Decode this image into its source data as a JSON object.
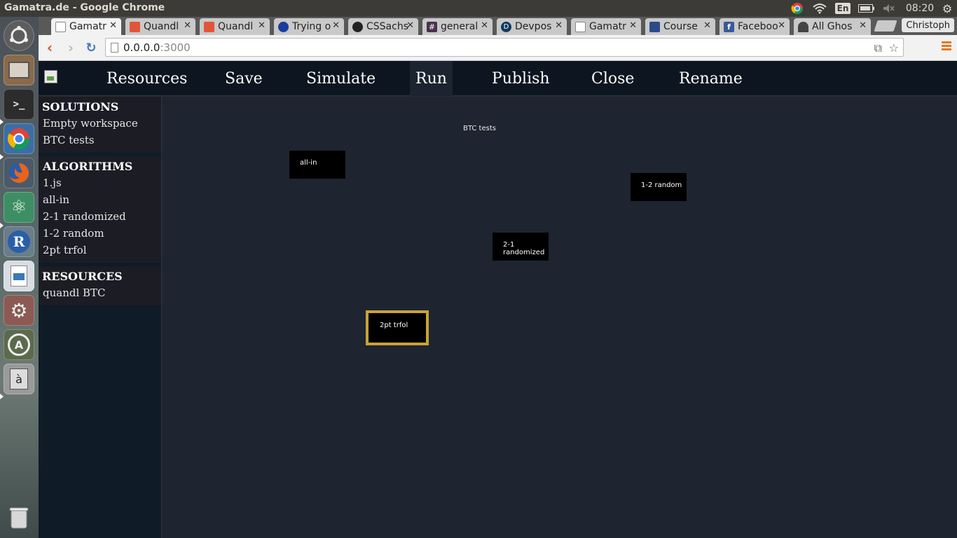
{
  "os": {
    "window_title": "Gamatra.de - Google Chrome",
    "keyboard_lang": "En",
    "clock": "08:20"
  },
  "launcher": {
    "apps": [
      {
        "name": "ubuntu-dash",
        "glyph": "◎",
        "color": "#5d5d5d"
      },
      {
        "name": "files",
        "glyph": "▭",
        "color": "#8a6a4a"
      },
      {
        "name": "terminal",
        "glyph": ">_",
        "color": "#2c2c2c"
      },
      {
        "name": "chrome",
        "glyph": "◉",
        "color": "#3a6ea5"
      },
      {
        "name": "firefox",
        "glyph": "◉",
        "color": "#d8641c"
      },
      {
        "name": "atom",
        "glyph": "⚛",
        "color": "#3e8e64"
      },
      {
        "name": "r-studio",
        "glyph": "R",
        "color": "#2a5fa8"
      },
      {
        "name": "libreoffice-writer",
        "glyph": "▤",
        "color": "#d8dde3"
      },
      {
        "name": "system-settings",
        "glyph": "⚙",
        "color": "#b03a2e"
      },
      {
        "name": "software-updater",
        "glyph": "A",
        "color": "#5c6a4c"
      },
      {
        "name": "character-map",
        "glyph": "à",
        "color": "#9a9a9a"
      },
      {
        "name": "trash",
        "glyph": "🗑",
        "color": "#7d8a8a"
      }
    ]
  },
  "browser": {
    "tabs": [
      {
        "label": "Gamatr",
        "favicon": "#ffffff",
        "active": true
      },
      {
        "label": "Quandl",
        "favicon": "#e2553b"
      },
      {
        "label": "Quandl",
        "favicon": "#e2553b"
      },
      {
        "label": "Trying o",
        "favicon": "#1a3d9c"
      },
      {
        "label": "CSSachs",
        "favicon": "#222222"
      },
      {
        "label": "general",
        "favicon": "#4a2f4a"
      },
      {
        "label": "Devpos",
        "favicon": "#123a5c"
      },
      {
        "label": "Gamatr",
        "favicon": "#ffffff"
      },
      {
        "label": "Course",
        "favicon": "#2a4a8a"
      },
      {
        "label": "Faceboo",
        "favicon": "#3b5998"
      },
      {
        "label": "All Ghos",
        "favicon": "#444444"
      }
    ],
    "profile": "Christoph",
    "url_host": "0.0.0.0",
    "url_port": ":3000"
  },
  "app": {
    "nav": [
      "Resources",
      "Save",
      "Simulate",
      "Run",
      "Publish",
      "Close",
      "Rename"
    ],
    "active_nav": "Run",
    "sidebar": {
      "solutions": {
        "heading": "SOLUTIONS",
        "items": [
          "Empty workspace",
          "BTC tests"
        ]
      },
      "algorithms": {
        "heading": "ALGORITHMS",
        "items": [
          "1.js",
          "all-in",
          "2-1 randomized",
          "1-2 random",
          "2pt trfol"
        ]
      },
      "resources": {
        "heading": "RESOURCES",
        "items": [
          "quandl BTC"
        ]
      }
    },
    "canvas": {
      "title": "BTC tests",
      "nodes": [
        "all-in",
        "1-2 random",
        "2-1 randomized",
        "2pt trfol"
      ],
      "selected_node": "2pt trfol",
      "selection_color": "#c9a238"
    }
  }
}
